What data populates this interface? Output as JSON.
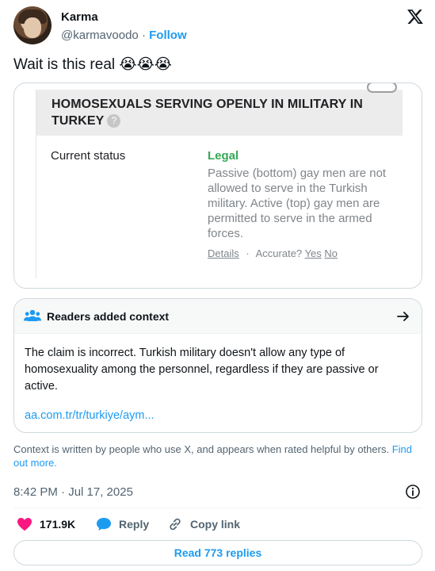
{
  "author": {
    "name": "Karma",
    "handle": "@karmavoodo",
    "separator": "·",
    "follow_label": "Follow"
  },
  "tweet": {
    "text": "Wait is this real 😭😭😭"
  },
  "screenshot": {
    "title": "HOMOSEXUALS SERVING OPENLY IN MILITARY IN TURKEY",
    "help_glyph": "?",
    "status_label": "Current status",
    "status_value": "Legal",
    "description": "Passive (bottom) gay men are not allowed to serve in the Turkish military. Active (top) gay men are permitted to serve in the armed forces.",
    "details_label": "Details",
    "dot": "·",
    "accurate_label": "Accurate?",
    "yes_label": "Yes",
    "no_label": "No"
  },
  "community_note": {
    "title": "Readers added context",
    "body": "The claim is incorrect. Turkish military doesn't allow any type of homosexuality among the personnel, regardless if they are passive or active.",
    "link": "aa.com.tr/tr/turkiye/aym..."
  },
  "context_footer": {
    "text": "Context is written by people who use X, and appears when rated helpful by others.",
    "find_out_more": "Find out more."
  },
  "meta": {
    "timestamp": "8:42 PM · Jul 17, 2025"
  },
  "actions": {
    "likes": "171.9K",
    "reply_label": "Reply",
    "copy_link_label": "Copy link"
  },
  "replies_button": "Read 773 replies",
  "colors": {
    "accent": "#1d9bf0",
    "like": "#f91880",
    "legal_green": "#34a853"
  }
}
